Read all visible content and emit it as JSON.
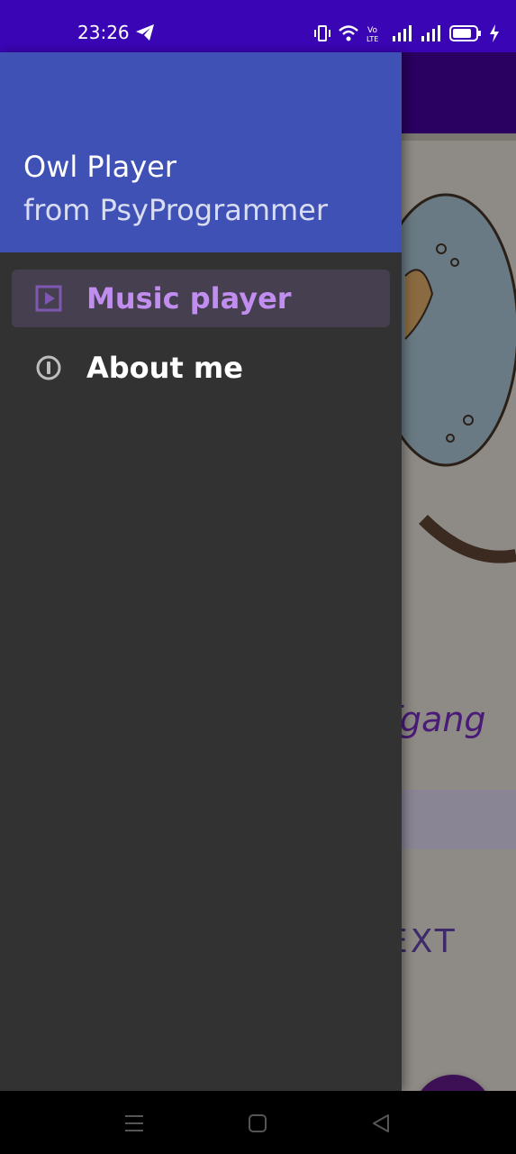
{
  "status_bar": {
    "time": "23:26",
    "color": "#3a05b5",
    "icons": [
      "telegram-icon",
      "vibrate-icon",
      "wifi-icon",
      "volte-icon",
      "signal-icon",
      "signal-icon",
      "battery-icon",
      "charging-icon"
    ]
  },
  "background_app": {
    "artist_partial": "lfgang",
    "next_partial": "EXT",
    "fab_icon": "send-icon"
  },
  "drawer": {
    "header_color": "#3f51b5",
    "title": "Owl Player",
    "subtitle": "from PsyProgrammer",
    "accent": "#c18ef0",
    "items": [
      {
        "label": "Music player",
        "icon": "play-box-icon",
        "selected": true
      },
      {
        "label": "About me",
        "icon": "info-icon",
        "selected": false
      }
    ]
  },
  "nav_bar": {
    "buttons": [
      "menu-icon",
      "home-icon",
      "back-icon"
    ]
  }
}
